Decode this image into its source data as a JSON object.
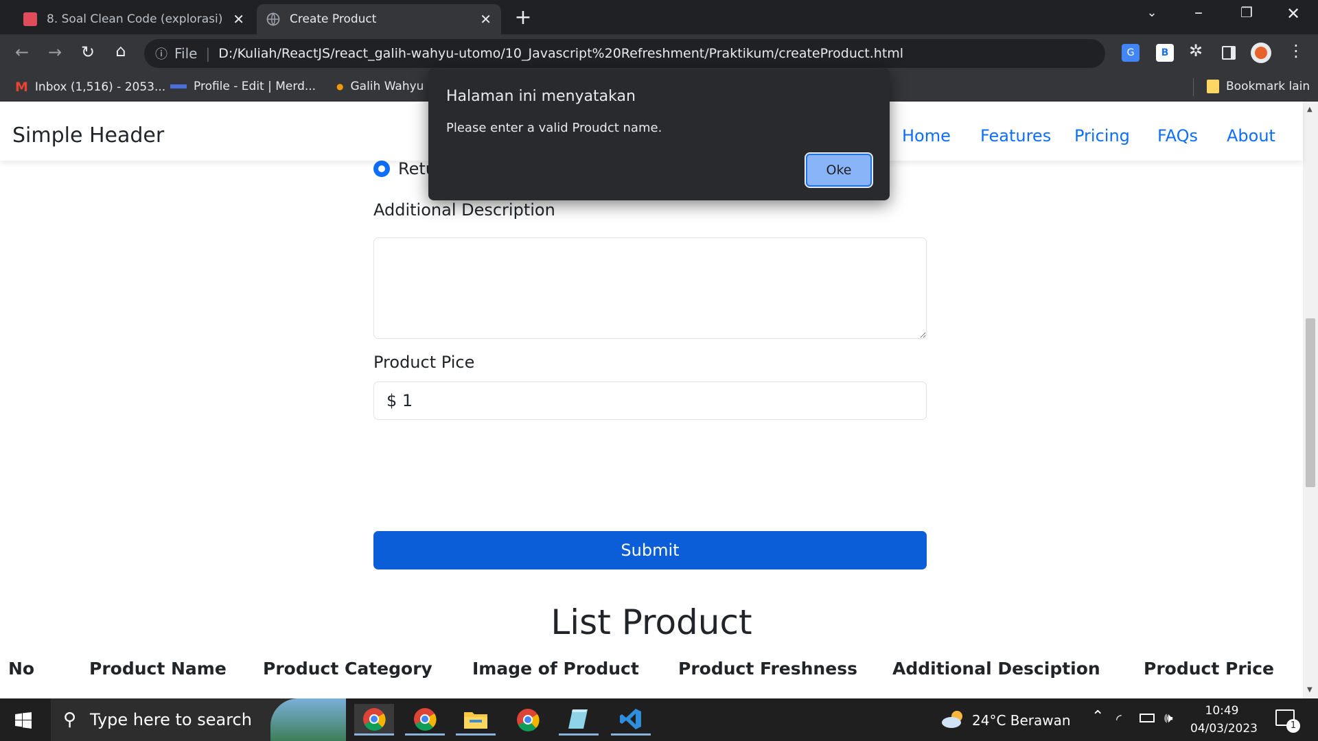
{
  "browser": {
    "tabs": [
      {
        "title": "8. Soal Clean Code (explorasi)",
        "color": "#e04c5a"
      },
      {
        "title": "Create Product"
      }
    ],
    "address": {
      "scheme": "File",
      "url": "D:/Kuliah/ReactJS/react_galih-wahyu-utomo/10_Javascript%20Refreshment/Praktikum/createProduct.html"
    },
    "bookmarks": [
      "Inbox (1,516) - 2053...",
      "Profile - Edit | Merd...",
      "Galih Wahyu U"
    ],
    "bookmarks_other": "Bookmark lain"
  },
  "page": {
    "brand": "Simple Header",
    "nav": [
      "Home",
      "Features",
      "Pricing",
      "FAQs",
      "About"
    ],
    "radio_partial_label": "Retu",
    "description_label": "Additional Description",
    "price_label": "Product Pice",
    "price_value": "$ 1",
    "submit_label": "Submit",
    "list_title": "List Product",
    "table_headers": [
      "No",
      "Product Name",
      "Product Category",
      "Image of Product",
      "Product Freshness",
      "Additional Desciption",
      "Product Price"
    ]
  },
  "dialog": {
    "title": "Halaman ini menyatakan",
    "message": "Please enter a valid Proudct name.",
    "ok_label": "Oke"
  },
  "taskbar": {
    "search_placeholder": "Type here to search",
    "weather": "24°C  Berawan",
    "time": "10:49",
    "date": "04/03/2023",
    "notifications": "1"
  },
  "colors": {
    "accent": "#0b5ed7",
    "link": "#0d6efd"
  }
}
